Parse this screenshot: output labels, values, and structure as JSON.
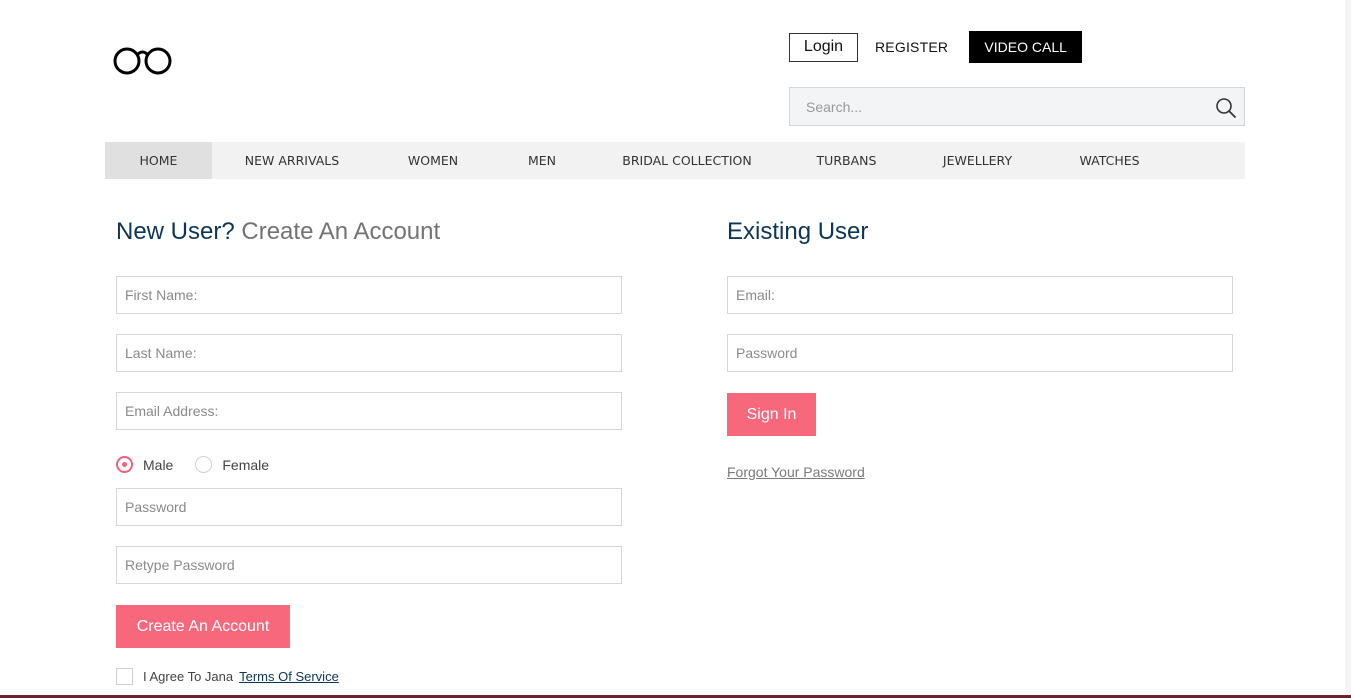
{
  "header": {
    "login_label": "Login",
    "register_label": "REGISTER",
    "video_call_label": "VIDEO CALL",
    "search_placeholder": "Search..."
  },
  "nav": {
    "items": [
      {
        "label": "HOME",
        "active": true
      },
      {
        "label": "NEW ARRIVALS"
      },
      {
        "label": "WOMEN"
      },
      {
        "label": "MEN"
      },
      {
        "label": "BRIDAL COLLECTION"
      },
      {
        "label": "TURBANS"
      },
      {
        "label": "JEWELLERY"
      },
      {
        "label": "WATCHES"
      }
    ]
  },
  "register": {
    "heading_main": "New User?",
    "heading_sub": "Create An Account",
    "first_name_placeholder": "First Name:",
    "last_name_placeholder": "Last Name:",
    "email_placeholder": "Email Address:",
    "gender_male": "Male",
    "gender_female": "Female",
    "gender_selected": "Male",
    "password_placeholder": "Password",
    "retype_password_placeholder": "Retype Password",
    "submit_label": "Create An Account",
    "agree_text": "I Agree To Jana",
    "terms_label": "Terms Of Service"
  },
  "login": {
    "heading": "Existing User",
    "email_placeholder": "Email:",
    "password_placeholder": "Password",
    "submit_label": "Sign In",
    "forgot_label": "Forgot Your Password"
  },
  "colors": {
    "accent": "#f8687d",
    "heading": "#0d3656",
    "muted_heading": "#737373",
    "nav_background": "#f2f2f2",
    "video_call_background": "#000000"
  }
}
